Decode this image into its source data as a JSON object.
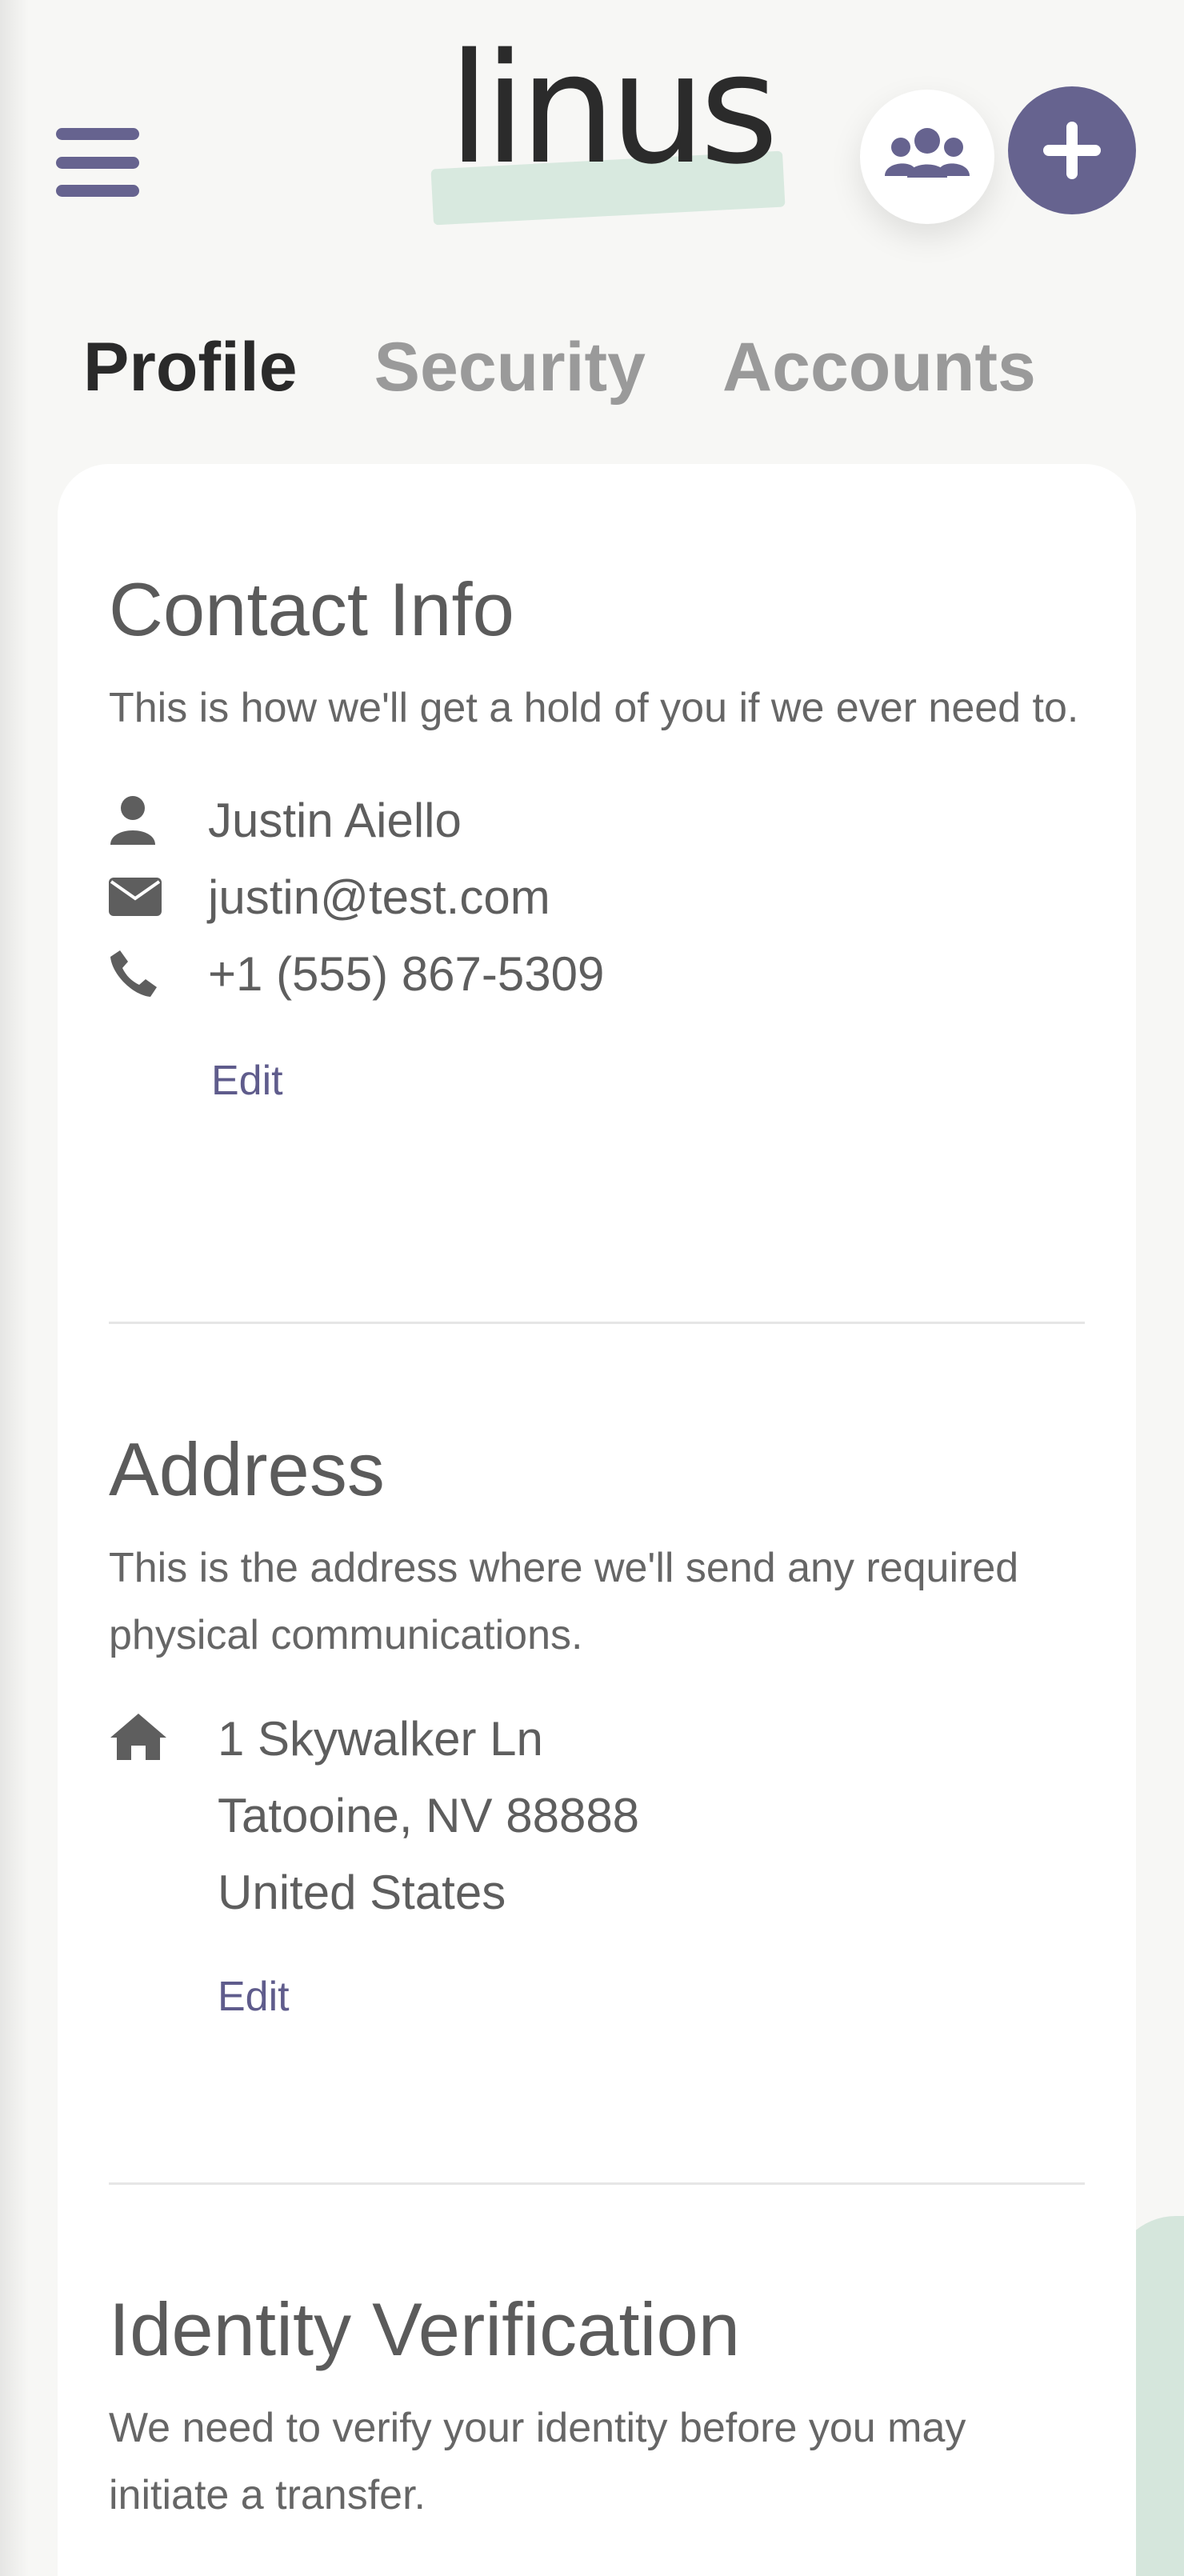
{
  "header": {
    "logo_text": "linus",
    "menu_icon": "hamburger-menu-icon",
    "team_icon": "users-icon",
    "add_icon": "plus-icon"
  },
  "tabs": [
    {
      "label": "Profile",
      "active": true
    },
    {
      "label": "Security",
      "active": false
    },
    {
      "label": "Accounts",
      "active": false
    }
  ],
  "contact": {
    "title": "Contact Info",
    "description": "This is how we'll get a hold of you if we ever need to.",
    "name": "Justin Aiello",
    "email": "justin@test.com",
    "phone": "+1 (555) 867-5309",
    "edit_label": "Edit"
  },
  "address": {
    "title": "Address",
    "description": "This is the address where we'll send any required physical communications.",
    "line1": "1 Skywalker Ln",
    "line2": "Tatooine, NV 88888",
    "line3": "United States",
    "edit_label": "Edit"
  },
  "identity": {
    "title": "Identity Verification",
    "description": "We need to verify your identity before you may initiate a transfer."
  },
  "colors": {
    "accent": "#66638f",
    "logo_highlight": "#d8e9df",
    "active_tab": "#2a2a2a",
    "inactive_tab": "#9a9a9a"
  }
}
